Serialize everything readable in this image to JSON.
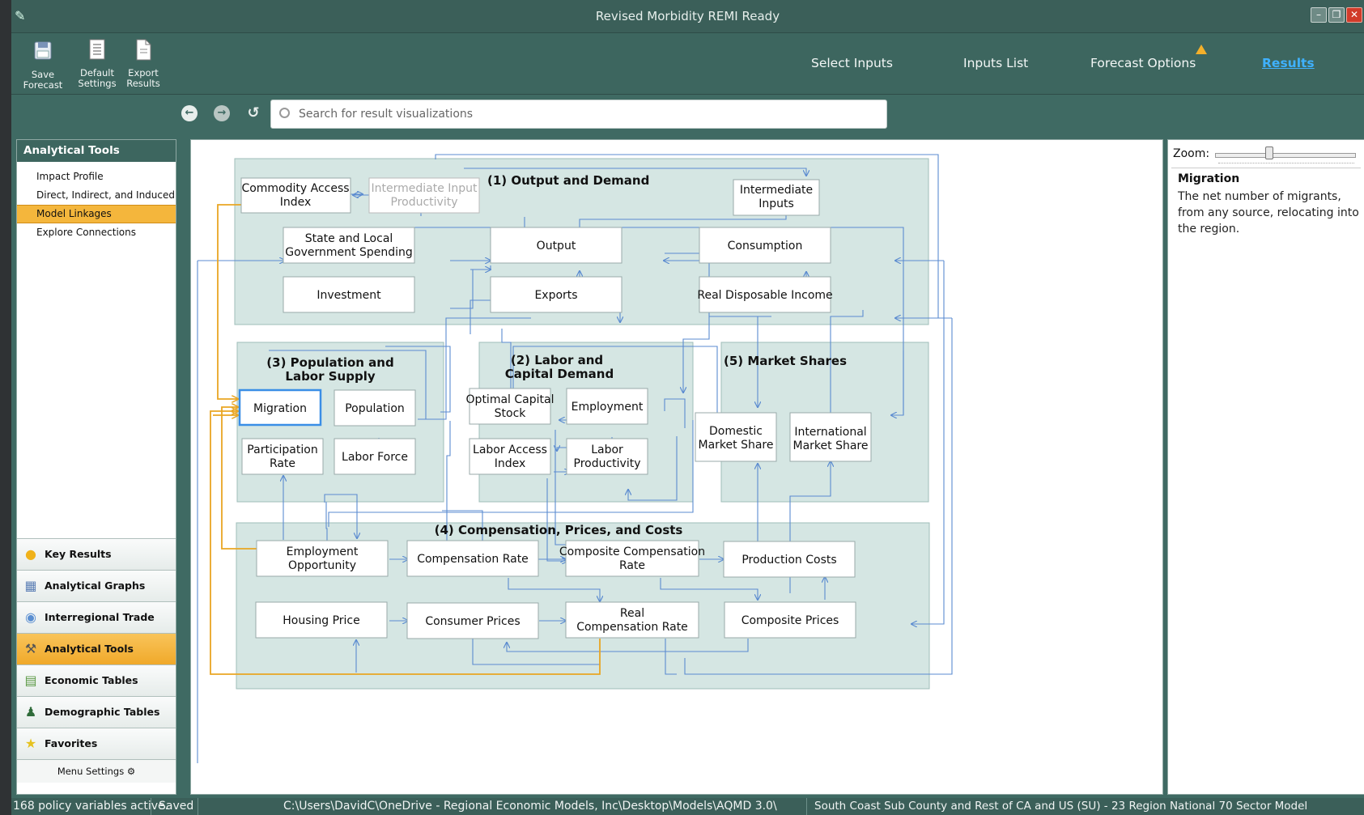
{
  "window": {
    "title": "Revised Morbidity REMI Ready"
  },
  "toolbar": {
    "save_label": "Save Forecast",
    "default_label_1": "Default",
    "default_label_2": "Settings",
    "export_label_1": "Export",
    "export_label_2": "Results"
  },
  "nav": {
    "select_inputs": "Select Inputs",
    "inputs_list": "Inputs List",
    "forecast_options": "Forecast Options",
    "results": "Results"
  },
  "search": {
    "placeholder": "Search for result visualizations",
    "value": ""
  },
  "left_panel": {
    "header": "Analytical Tools",
    "items": [
      "Impact Profile",
      "Direct, Indirect, and Induced",
      "Model Linkages",
      "Explore Connections"
    ],
    "selected": "Model Linkages",
    "categories": [
      {
        "label": "Key Results",
        "icon": "lightbulb-icon"
      },
      {
        "label": "Analytical Graphs",
        "icon": "graph-icon"
      },
      {
        "label": "Interregional Trade",
        "icon": "globe-icon"
      },
      {
        "label": "Analytical Tools",
        "icon": "tools-icon"
      },
      {
        "label": "Economic Tables",
        "icon": "money-icon"
      },
      {
        "label": "Demographic Tables",
        "icon": "people-icon"
      },
      {
        "label": "Favorites",
        "icon": "star-icon"
      }
    ],
    "selected_category": "Analytical Tools",
    "menu_settings": "Menu Settings"
  },
  "diagram": {
    "groups": {
      "g1": "(1) Output and Demand",
      "g2_1": "(2) Labor and",
      "g2_2": "Capital Demand",
      "g3_1": "(3) Population and",
      "g3_2": "Labor Supply",
      "g4": "(4) Compensation,  Prices, and Costs",
      "g5": "(5) Market Shares"
    },
    "nodes": {
      "commodity_access_index_1": "Commodity Access",
      "commodity_access_index_2": "Index",
      "intermediate_input_productivity_1": "Intermediate Input",
      "intermediate_input_productivity_2": "Productivity",
      "intermediate_inputs_1": "Intermediate",
      "intermediate_inputs_2": "Inputs",
      "state_local_gov_1": "State and Local",
      "state_local_gov_2": "Government Spending",
      "output": "Output",
      "consumption": "Consumption",
      "investment": "Investment",
      "exports": "Exports",
      "real_disposable_income": "Real Disposable Income",
      "migration": "Migration",
      "population": "Population",
      "participation_rate_1": "Participation",
      "participation_rate_2": "Rate",
      "labor_force": "Labor Force",
      "optimal_capital_stock_1": "Optimal Capital",
      "optimal_capital_stock_2": "Stock",
      "employment": "Employment",
      "labor_access_index_1": "Labor Access",
      "labor_access_index_2": "Index",
      "labor_productivity_1": "Labor",
      "labor_productivity_2": "Productivity",
      "domestic_market_share_1": "Domestic",
      "domestic_market_share_2": "Market Share",
      "international_market_share_1": "International",
      "international_market_share_2": "Market Share",
      "employment_opportunity_1": "Employment",
      "employment_opportunity_2": "Opportunity",
      "compensation_rate": "Compensation Rate",
      "composite_compensation_rate_1": "Composite Compensation",
      "composite_compensation_rate_2": "Rate",
      "production_costs": "Production Costs",
      "housing_price": "Housing Price",
      "consumer_prices": "Consumer Prices",
      "real_compensation_rate_1": "Real",
      "real_compensation_rate_2": "Compensation Rate",
      "composite_prices": "Composite Prices"
    },
    "selected_node": "Migration"
  },
  "right_panel": {
    "zoom_label": "Zoom:",
    "zoom_level": 0.37,
    "title": "Migration",
    "description": "The net number of migrants, from any source, relocating into the region."
  },
  "status": {
    "policy": "168 policy variables active.",
    "saved": "Saved",
    "path": "C:\\Users\\DavidC\\OneDrive - Regional Economic Models, Inc\\Desktop\\Models\\AQMD 3.0\\",
    "model": "South Coast Sub County and Rest of CA and US (SU) -  23 Region National 70 Sector Model"
  },
  "colors": {
    "accent": "#3d665f",
    "highlight": "#f4b63c",
    "link": "#3fb1ff",
    "edge": "#5b8bd0",
    "feedback": "#e9a623"
  }
}
